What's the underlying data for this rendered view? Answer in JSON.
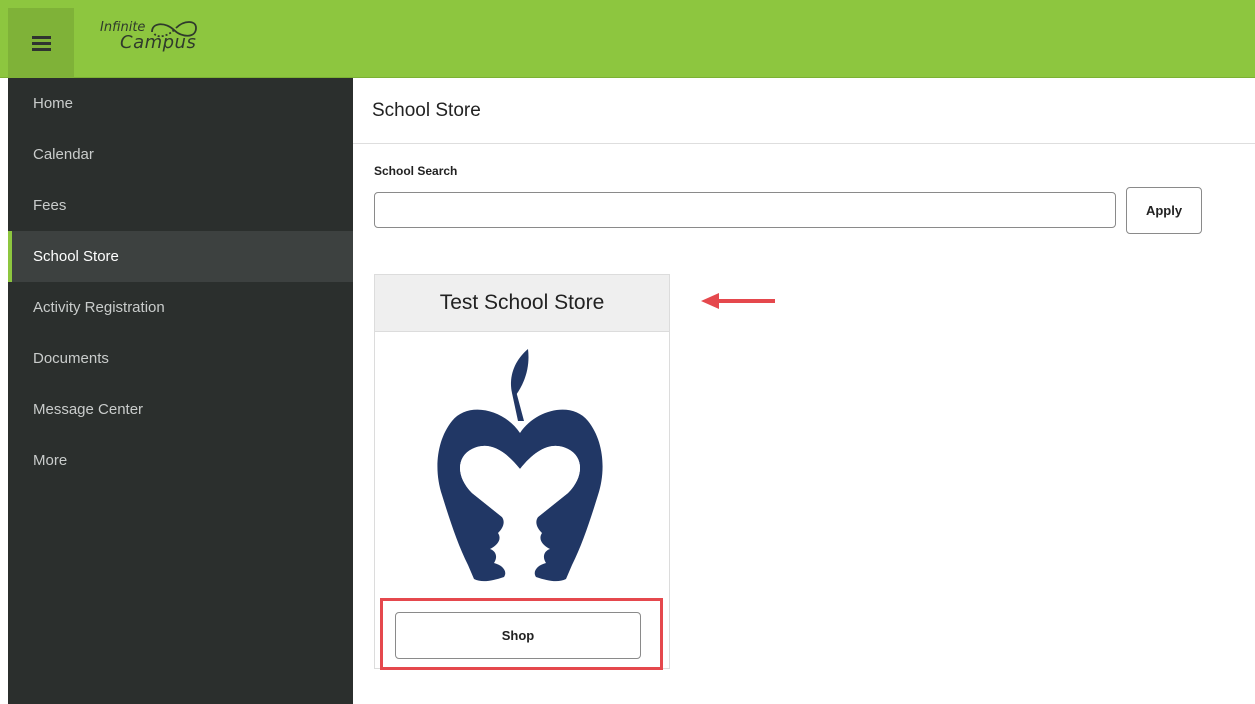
{
  "app": {
    "logo_line1": "Infinite",
    "logo_line2": "Campus",
    "brand_color": "#8dc63f",
    "sidebar_color": "#2b2f2d"
  },
  "sidebar": {
    "items": [
      {
        "label": "Home",
        "active": false
      },
      {
        "label": "Calendar",
        "active": false
      },
      {
        "label": "Fees",
        "active": false
      },
      {
        "label": "School Store",
        "active": true
      },
      {
        "label": "Activity Registration",
        "active": false
      },
      {
        "label": "Documents",
        "active": false
      },
      {
        "label": "Message Center",
        "active": false
      },
      {
        "label": "More",
        "active": false
      }
    ]
  },
  "main": {
    "title": "School Store",
    "search": {
      "label": "School Search",
      "value": "",
      "placeholder": "",
      "apply_label": "Apply"
    },
    "stores": [
      {
        "name": "Test School Store",
        "logo": "apple-heart-faces-logo",
        "shop_label": "Shop"
      }
    ]
  },
  "annotations": {
    "arrow_color": "#e5484d",
    "highlight_color": "#e5484d"
  }
}
